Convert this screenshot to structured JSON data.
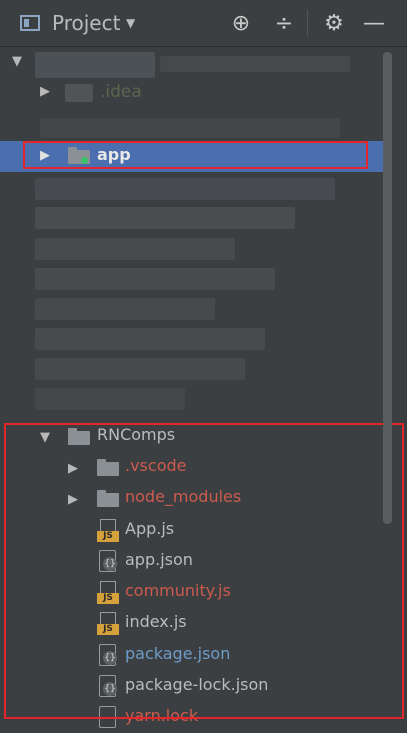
{
  "header": {
    "title": "Project",
    "dropdown_arrow": "▼",
    "icons": {
      "locate": "⊕",
      "collapse": "÷",
      "settings": "⚙",
      "hide": "—"
    }
  },
  "tree": {
    "root_arrow": "▼",
    "idea_label": ".idea",
    "app_label": "app",
    "rncomps_label": "RNComps",
    "children": [
      {
        "label": ".vscode",
        "kind": "folder",
        "color": "red"
      },
      {
        "label": "node_modules",
        "kind": "folder",
        "color": "red"
      },
      {
        "label": "App.js",
        "kind": "js",
        "color": "default"
      },
      {
        "label": "app.json",
        "kind": "json",
        "color": "default"
      },
      {
        "label": "community.js",
        "kind": "js",
        "color": "red"
      },
      {
        "label": "index.js",
        "kind": "js",
        "color": "default"
      },
      {
        "label": "package.json",
        "kind": "json",
        "color": "blue"
      },
      {
        "label": "package-lock.json",
        "kind": "json",
        "color": "default"
      },
      {
        "label": "yarn.lock",
        "kind": "file",
        "color": "red"
      }
    ]
  },
  "colors": {
    "background": "#3c3f41",
    "selection": "#4b6eaf",
    "highlight_border": "#e2262c",
    "ignored_text": "#cc5b4e",
    "modified_text": "#6d9cc9"
  }
}
